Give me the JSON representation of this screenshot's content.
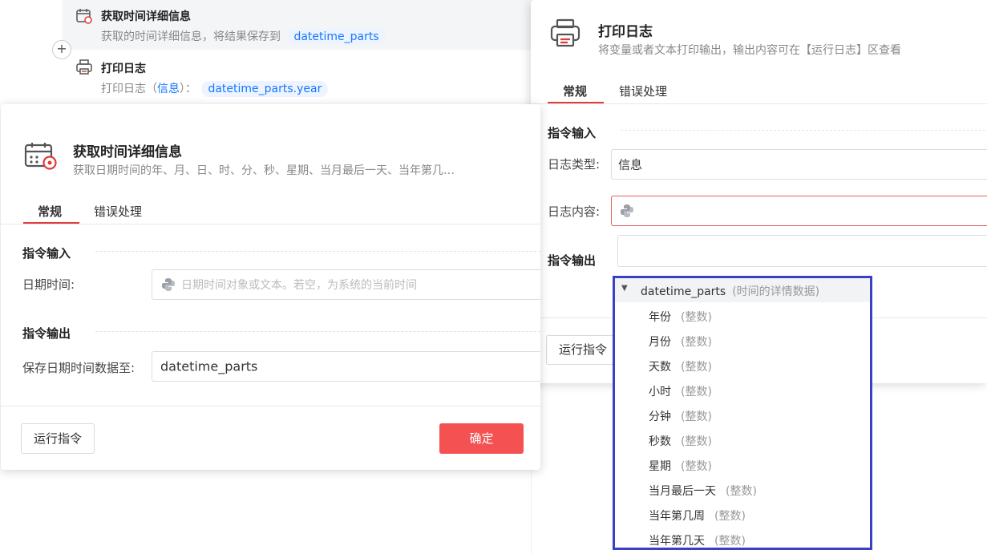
{
  "workflow": {
    "item1": {
      "title": "获取时间详细信息",
      "desc": "获取的时间详细信息，将结果保存到",
      "chip": "datetime_parts"
    },
    "item2": {
      "title": "打印日志",
      "desc_prefix": "打印日志（",
      "desc_link": "信息",
      "desc_suffix": "）：",
      "chip": "datetime_parts.year"
    },
    "add_symbol": "+"
  },
  "dialog1": {
    "title": "获取时间详细信息",
    "subtitle": "获取日期时间的年、月、日、时、分、秒、星期、当月最后一天、当年第几…",
    "tabs": [
      "常规",
      "错误处理"
    ],
    "section_input": "指令输入",
    "datetime_label": "日期时间:",
    "datetime_placeholder": "日期时间对象或文本。若空，为系统的当前时间",
    "section_output": "指令输出",
    "save_label": "保存日期时间数据至:",
    "save_value": "datetime_parts",
    "run_button": "运行指令",
    "confirm_button": "确定"
  },
  "dialog2": {
    "title": "打印日志",
    "subtitle": "将变量或者文本打印输出，输出内容可在【运行日志】区查看",
    "tabs": [
      "常规",
      "错误处理"
    ],
    "section_input": "指令输入",
    "log_type_label": "日志类型:",
    "log_type_value": "信息",
    "log_content_label": "日志内容:",
    "section_output": "指令输出",
    "run_button": "运行指令"
  },
  "dropdown": {
    "root_name": "datetime_parts",
    "root_hint": "(时间的详情数据)",
    "items": [
      {
        "name": "年份",
        "type": "(整数)"
      },
      {
        "name": "月份",
        "type": "(整数)"
      },
      {
        "name": "天数",
        "type": "(整数)"
      },
      {
        "name": "小时",
        "type": "(整数)"
      },
      {
        "name": "分钟",
        "type": "(整数)"
      },
      {
        "name": "秒数",
        "type": "(整数)"
      },
      {
        "name": "星期",
        "type": "(整数)"
      },
      {
        "name": "当月最后一天",
        "type": "(整数)"
      },
      {
        "name": "当年第几周",
        "type": "(整数)"
      },
      {
        "name": "当年第几天",
        "type": "(整数)"
      }
    ]
  },
  "colors": {
    "accent_red": "#f45252",
    "chip_blue": "#1677ff",
    "highlight_border": "#3b3fc4"
  }
}
